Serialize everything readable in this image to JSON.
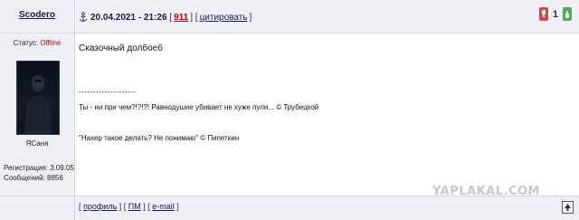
{
  "post": {
    "author": "Scodero",
    "date": "20.04.2021 - 21:26",
    "number": "911",
    "quote_label": "цитировать",
    "rating": "1",
    "status_label": "Статус:",
    "status_value": "Offline",
    "avatar_caption": "ЯСаня",
    "registration": "Регистрация: 3.09.05",
    "messages": "Сообщений: 8856",
    "body": {
      "line1": "Сказочный долбоеб",
      "separator": "--------------------",
      "line2": "Ты - ни при чем?!?!?! Равнодушие убивает не хуже пули... © Трубецкой",
      "line3": "\"Нахер такое делать? Не понимаю\" © Пипеткин"
    }
  },
  "footer": {
    "profile": "профиль",
    "pm": "ПМ",
    "email": "e-mail"
  },
  "watermark": "YAPLAKAL.COM",
  "icons": {
    "anchor": "post-anchor-icon",
    "vote_down": "thumb-down-icon",
    "vote_up": "thumb-up-icon",
    "top": "arrow-up-icon"
  },
  "colors": {
    "header_bg": "#eef0f6",
    "accent_red": "#b00000",
    "vote_down": "#d24a4a",
    "vote_up": "#4caf50"
  }
}
